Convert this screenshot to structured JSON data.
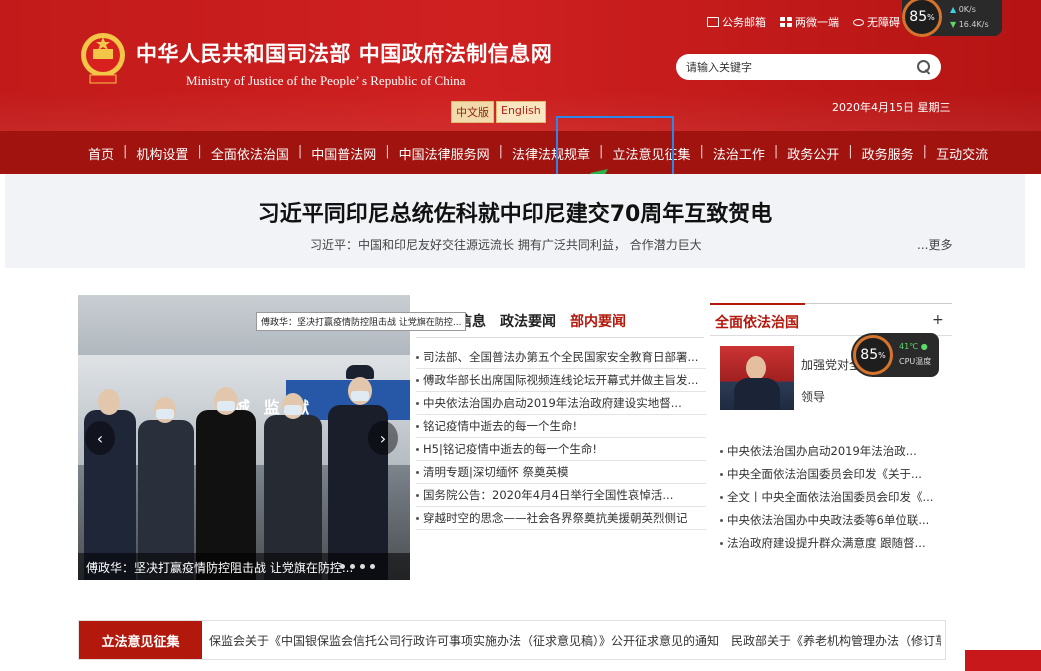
{
  "header": {
    "site_title": "中华人民共和国司法部 中国政府法制信息网",
    "site_subtitle": "Ministry of Justice of the People’ s Republic of China",
    "lang_cn": "中文版",
    "lang_en": "English",
    "top_links": [
      {
        "label": "公务邮箱",
        "icon": "mail-icon"
      },
      {
        "label": "两微一端",
        "icon": "grid-icon"
      },
      {
        "label": "无障碍",
        "icon": "eye-icon"
      }
    ],
    "search_placeholder": "请输入关键字",
    "date": "2020年4月15日 星期三"
  },
  "net_widget": {
    "percent": "85",
    "unit": "%",
    "up_rate": "0K/s",
    "down_rate": "16.4K/s"
  },
  "nav": {
    "items": [
      "首页",
      "机构设置",
      "全面依法治国",
      "中国普法网",
      "中国法律服务网",
      "法律法规规章",
      "立法意见征集",
      "法治工作",
      "政务公开",
      "政务服务",
      "互动交流"
    ],
    "separator": "|"
  },
  "headline": {
    "title": "习近平同印尼总统佐科就中印尼建交70周年互致贺电",
    "subtitle": "习近平：中国和印尼友好交往源远流长 拥有广泛共同利益， 合作潜力巨大",
    "more": "...更多"
  },
  "slider": {
    "tooltip": "傅政华：坚决打赢疫情防控阻击战 让党旗在防控...",
    "caption": "傅政华：坚决打赢疫情防控阻击战 让党旗在防控...",
    "sign_text": "城 监 狱",
    "prev_icon": "chevron-left-icon",
    "next_icon": "chevron-right-icon",
    "dot_count": 4
  },
  "news": {
    "tabs": [
      "信息",
      "政法要闻",
      "部内要闻"
    ],
    "active_tab": "部内要闻",
    "items": [
      "司法部、全国普法办第五个全民国家安全教育日部署...",
      "傅政华部长出席国际视频连线论坛开幕式并做主旨发...",
      "中央依法治国办启动2019年法治政府建设实地督...",
      "铭记疫情中逝去的每一个生命!",
      "H5|铭记疫情中逝去的每一个生命!",
      "清明专题|深切缅怀 祭奠英模",
      "国务院公告：2020年4月4日举行全国性哀悼活...",
      "穿越时空的思念——社会各界祭奠抗美援朝英烈侧记"
    ]
  },
  "right_column": {
    "title": "全面依法治国",
    "more_icon": "plus-icon",
    "feature_title": "加强党对全",
    "feature_sub": "领导",
    "items": [
      "中央依法治国办启动2019年法治政...",
      "中央全面依法治国委员会印发《关于...",
      "全文丨中央全面依法治国委员会印发《...",
      "中央依法治国办中央政法委等6单位联...",
      "法治政府建设提升群众满意度 跟随督..."
    ]
  },
  "cpu_widget": {
    "percent": "85",
    "unit": "%",
    "temp": "41℃",
    "label": "CPU温度"
  },
  "ticker": {
    "label": "立法意见征集",
    "text": "保监会关于《中国银保监会信托公司行政许可事项实施办法（征求意见稿）》公开征求意见的通知　民政部关于《养老机构管理办法（修订草"
  },
  "colors": {
    "brand_red": "#c21a1a",
    "nav_red": "#a0130f",
    "annotation_blue": "#2f86e8",
    "annotation_green": "#28b44a"
  }
}
